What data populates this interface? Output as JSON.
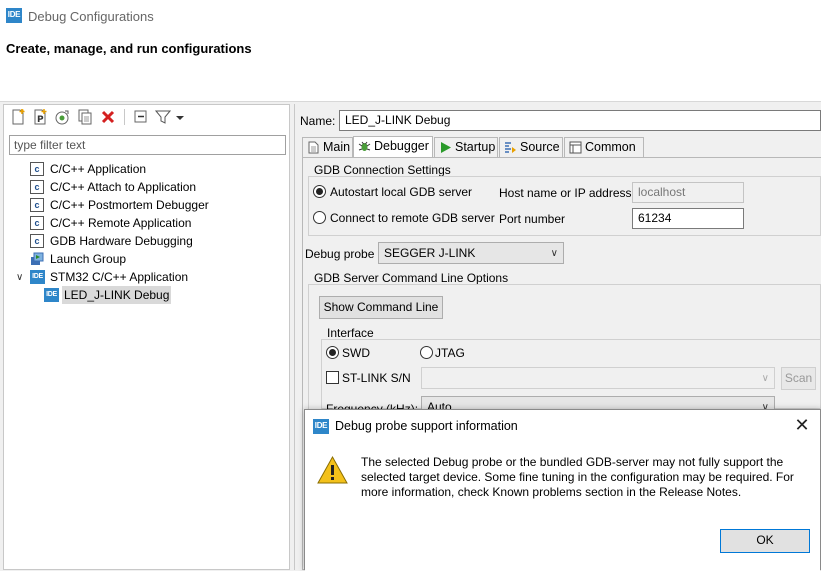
{
  "window": {
    "title": "Debug Configurations",
    "badge": "IDE"
  },
  "header": {
    "heading": "Create, manage, and run configurations"
  },
  "left_panel": {
    "toolbar_icons": [
      "new-config-icon",
      "new-prototype-icon",
      "export-icon",
      "duplicate-icon",
      "delete-icon",
      "collapse-all-icon",
      "filter-icon",
      "view-menu-icon"
    ],
    "filter_placeholder": "type filter text",
    "tree": [
      {
        "label": "C/C++ Application",
        "icon": "c-config-icon",
        "indent": 0
      },
      {
        "label": "C/C++ Attach to Application",
        "icon": "c-config-icon",
        "indent": 0
      },
      {
        "label": "C/C++ Postmortem Debugger",
        "icon": "c-config-icon",
        "indent": 0
      },
      {
        "label": "C/C++ Remote Application",
        "icon": "c-config-icon",
        "indent": 0
      },
      {
        "label": "GDB Hardware Debugging",
        "icon": "c-config-icon",
        "indent": 0
      },
      {
        "label": "Launch Group",
        "icon": "launch-group-icon",
        "indent": 0
      },
      {
        "label": "STM32 C/C++ Application",
        "icon": "ide-icon",
        "indent": 0,
        "expanded": true
      },
      {
        "label": "LED_J-LINK Debug",
        "icon": "ide-icon",
        "indent": 1,
        "selected": true
      }
    ]
  },
  "right_panel": {
    "name_label": "Name:",
    "name_value": "LED_J-LINK Debug",
    "tabs": [
      "Main",
      "Debugger",
      "Startup",
      "Source",
      "Common"
    ],
    "active_tab": "Debugger",
    "gdb_connection": {
      "title": "GDB Connection Settings",
      "autostart_label": "Autostart local GDB server",
      "remote_label": "Connect to remote GDB server",
      "host_label": "Host name or IP address",
      "host_value": "localhost",
      "port_label": "Port number",
      "port_value": "61234"
    },
    "debug_probe": {
      "label": "Debug probe",
      "value": "SEGGER J-LINK"
    },
    "gdb_server_options": {
      "title": "GDB Server Command Line Options",
      "show_cmd_button": "Show Command Line",
      "interface_title": "Interface",
      "swd_label": "SWD",
      "jtag_label": "JTAG",
      "stlink_sn_label": "ST-LINK S/N",
      "scan_button": "Scan",
      "frequency_label": "Frequency (kHz):",
      "frequency_value": "Auto"
    }
  },
  "dialog": {
    "title": "Debug probe support information",
    "message": "The selected Debug probe or the bundled GDB-server may not fully support the selected target device. Some fine tuning in the configuration may be required. For more information, check Known problems section in the Release Notes.",
    "ok_label": "OK",
    "icon": "warning-icon"
  },
  "colors": {
    "accent": "#2e86c9",
    "warning": "#f3c11b"
  }
}
